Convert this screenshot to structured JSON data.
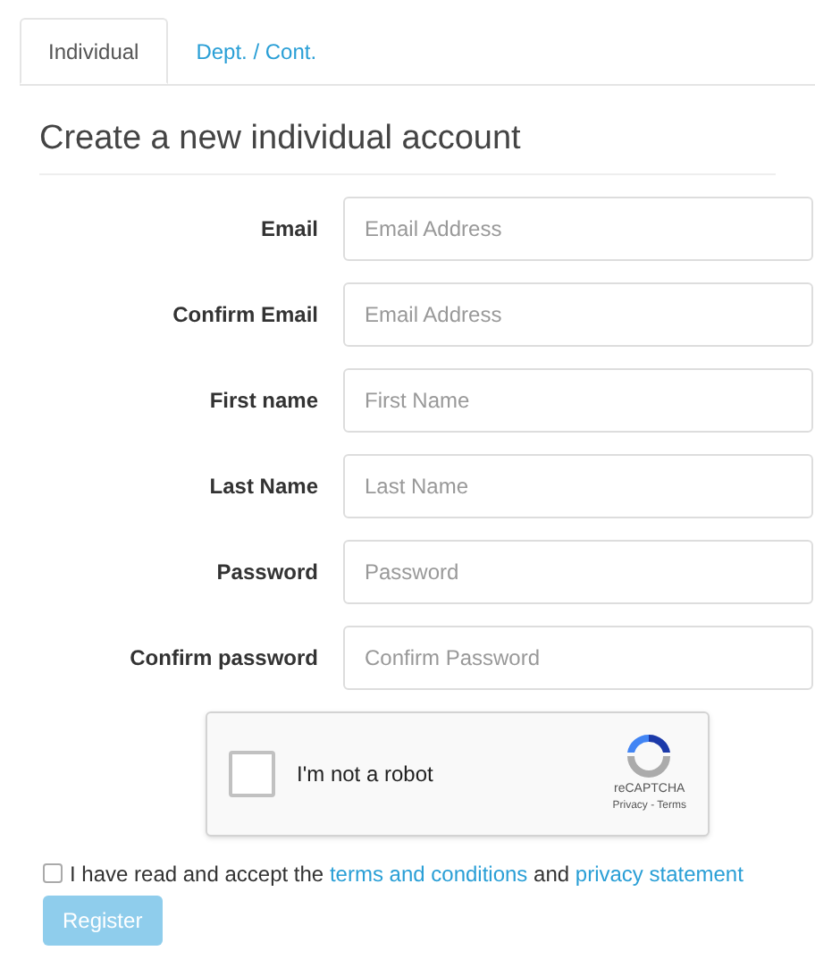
{
  "tabs": [
    {
      "label": "Individual",
      "selected": true
    },
    {
      "label": "Dept. / Cont.",
      "selected": false
    }
  ],
  "heading": "Create a new individual account",
  "fields": [
    {
      "label": "Email",
      "placeholder": "Email Address"
    },
    {
      "label": "Confirm Email",
      "placeholder": "Email Address"
    },
    {
      "label": "First name",
      "placeholder": "First Name"
    },
    {
      "label": "Last Name",
      "placeholder": "Last Name"
    },
    {
      "label": "Password",
      "placeholder": "Password"
    },
    {
      "label": "Confirm password",
      "placeholder": "Confirm Password"
    }
  ],
  "captcha": {
    "checked": false,
    "label": "I'm not a robot",
    "brand": "reCAPTCHA",
    "links": "Privacy - Terms"
  },
  "agreement": {
    "checked": false,
    "parts": [
      {
        "kind": "text",
        "text": "I have read and accept the"
      },
      {
        "kind": "link",
        "text": "terms and conditions"
      },
      {
        "kind": "text",
        "text": "and"
      },
      {
        "kind": "link",
        "text": "privacy statement"
      }
    ]
  },
  "register": {
    "label": "Register",
    "disabled": true
  }
}
